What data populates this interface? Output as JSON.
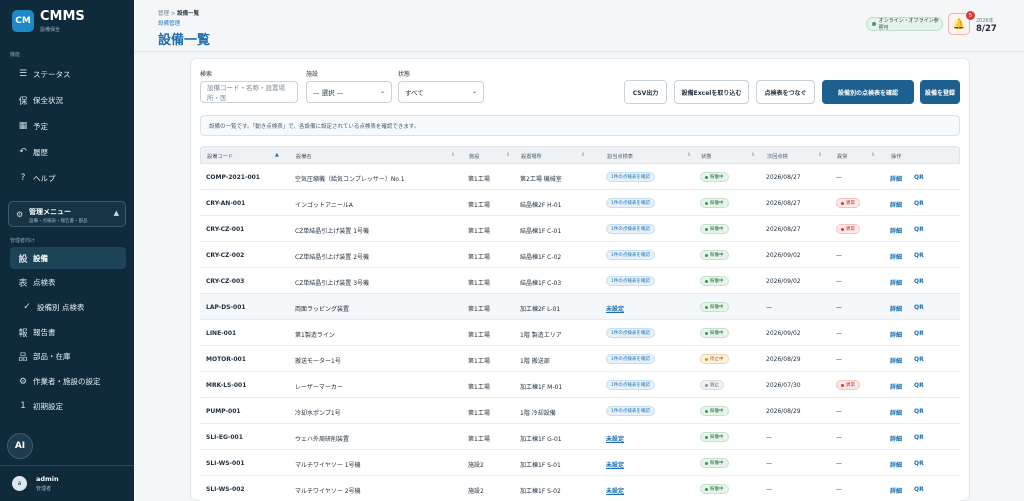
{
  "app": {
    "logo": "CM",
    "name": "CMMS",
    "subtitle": "設備保全"
  },
  "sidebar": {
    "section_main": "機能",
    "items": [
      {
        "label": "ステータス",
        "icon": "list-icon",
        "glyph": "☰"
      },
      {
        "label": "保全状況",
        "icon": "kanji-icon",
        "glyph": "保"
      },
      {
        "label": "予定",
        "icon": "calendar-icon",
        "glyph": "▦"
      },
      {
        "label": "履歴",
        "icon": "history-icon",
        "glyph": "↶"
      },
      {
        "label": "ヘルプ",
        "icon": "help-icon",
        "glyph": "?"
      }
    ],
    "mgmt": {
      "title": "管理メニュー",
      "subtitle": "設備・点検表・報告書・部品",
      "icon": "gear-icon"
    },
    "section_mgmt": "管理者向け",
    "mgmt_items": [
      {
        "label": "設備",
        "icon": "kanji-icon",
        "glyph": "設",
        "active": true
      },
      {
        "label": "点検表",
        "icon": "kanji-icon",
        "glyph": "表"
      },
      {
        "label": "設備別 点検表",
        "icon": "check-icon",
        "glyph": "✓"
      },
      {
        "label": "報告書",
        "icon": "kanji-icon",
        "glyph": "報"
      },
      {
        "label": "部品・在庫",
        "icon": "kanji-icon",
        "glyph": "品"
      },
      {
        "label": "作業者・施設の設定",
        "icon": "gear-icon",
        "glyph": "⚙"
      },
      {
        "label": "初期設定",
        "icon": "number-icon",
        "glyph": "1"
      }
    ],
    "ai_label": "AI",
    "user": {
      "avatar": "a",
      "name": "admin",
      "role": "管理者"
    }
  },
  "header": {
    "crumb_parent": "管理",
    "crumb_sep": ">",
    "crumb_current": "設備一覧",
    "sub_crumb": "設備管理",
    "title": "設備一覧",
    "online": "オンライン・オフライン参照可",
    "bell_count": "5",
    "year": "2026年",
    "date": "8/27"
  },
  "filters": {
    "search_label": "検索",
    "search_placeholder": "設備コード・名称・設置場所・医",
    "facility_label": "施設",
    "facility_value": "— 選択 —",
    "status_label": "状態",
    "status_value": "すべて"
  },
  "actions": {
    "csv": "CSV出力",
    "excel": "設備Excelを取り込む",
    "link": "点検表をつなぐ",
    "check": "設備別の点検表を確認",
    "register": "設備を登録"
  },
  "info_text": "設備の一覧です。「動き点検表」で、各設備に設定されている点検表を確認できます。",
  "table": {
    "headers": [
      "設備コード",
      "設備名",
      "施設",
      "設置場所",
      "割当点検表",
      "状態",
      "次回点検",
      "異常",
      "操作"
    ],
    "detail_label": "詳細",
    "qr_label": "QR",
    "rows": [
      {
        "code": "COMP-2021-001",
        "name": "空気圧縮機（給気コンプレッサー）No.1",
        "facility": "第1工場",
        "location": "第2工場 機械室",
        "checklist": "1件の点検表を確認",
        "unset": false,
        "status": "稼働中",
        "st": "g",
        "next": "2026/08/27",
        "abn": "—",
        "abnormal": false
      },
      {
        "code": "CRY-AN-001",
        "name": "インゴットアニールA",
        "facility": "第1工場",
        "location": "結晶棟2F H-01",
        "checklist": "1件の点検表を確認",
        "unset": false,
        "status": "稼働中",
        "st": "g",
        "next": "2026/08/27",
        "abn": "異常",
        "abnormal": true
      },
      {
        "code": "CRY-CZ-001",
        "name": "CZ単結晶引上げ装置 1号機",
        "facility": "第1工場",
        "location": "結晶棟1F C-01",
        "checklist": "1件の点検表を確認",
        "unset": false,
        "status": "稼働中",
        "st": "g",
        "next": "2026/08/27",
        "abn": "異常",
        "abnormal": true
      },
      {
        "code": "CRY-CZ-002",
        "name": "CZ単結晶引上げ装置 2号機",
        "facility": "第1工場",
        "location": "結晶棟1F C-02",
        "checklist": "1件の点検表を確認",
        "unset": false,
        "status": "稼働中",
        "st": "g",
        "next": "2026/09/02",
        "abn": "—",
        "abnormal": false
      },
      {
        "code": "CRY-CZ-003",
        "name": "CZ単結晶引上げ装置 3号機",
        "facility": "第1工場",
        "location": "結晶棟1F C-03",
        "checklist": "1件の点検表を確認",
        "unset": false,
        "status": "稼働中",
        "st": "g",
        "next": "2026/09/02",
        "abn": "—",
        "abnormal": false
      },
      {
        "code": "LAP-DS-001",
        "name": "両面ラッピング装置",
        "facility": "第1工場",
        "location": "加工棟2F L-01",
        "checklist": "未設定",
        "unset": true,
        "status": "稼働中",
        "st": "g",
        "next": "—",
        "abn": "—",
        "abnormal": false
      },
      {
        "code": "LINE-001",
        "name": "第1製造ライン",
        "facility": "第1工場",
        "location": "1階 製造エリア",
        "checklist": "1件の点検表を確認",
        "unset": false,
        "status": "稼働中",
        "st": "g",
        "next": "2026/09/02",
        "abn": "—",
        "abnormal": false
      },
      {
        "code": "MOTOR-001",
        "name": "搬送モーター1号",
        "facility": "第1工場",
        "location": "1階 搬送部",
        "checklist": "1件の点検表を確認",
        "unset": false,
        "status": "停止中",
        "st": "o",
        "next": "2026/08/29",
        "abn": "—",
        "abnormal": false
      },
      {
        "code": "MRK-LS-001",
        "name": "レーザーマーカー",
        "facility": "第1工場",
        "location": "加工棟1F M-01",
        "checklist": "1件の点検表を確認",
        "unset": false,
        "status": "廃止",
        "st": "x",
        "next": "2026/07/30",
        "abn": "異常",
        "abnormal": true
      },
      {
        "code": "PUMP-001",
        "name": "冷却水ポンプ1号",
        "facility": "第1工場",
        "location": "1階 冷却設備",
        "checklist": "1件の点検表を確認",
        "unset": false,
        "status": "稼働中",
        "st": "g",
        "next": "2026/08/29",
        "abn": "—",
        "abnormal": false
      },
      {
        "code": "SLI-EG-001",
        "name": "ウェハ外周研削装置",
        "facility": "第1工場",
        "location": "加工棟1F G-01",
        "checklist": "未設定",
        "unset": true,
        "status": "稼働中",
        "st": "g",
        "next": "—",
        "abn": "—",
        "abnormal": false
      },
      {
        "code": "SLI-WS-001",
        "name": "マルチワイヤソー 1号機",
        "facility": "施設2",
        "location": "加工棟1F S-01",
        "checklist": "未設定",
        "unset": true,
        "status": "稼働中",
        "st": "g",
        "next": "—",
        "abn": "—",
        "abnormal": false
      },
      {
        "code": "SLI-WS-002",
        "name": "マルチワイヤソー 2号機",
        "facility": "施設2",
        "location": "加工棟1F S-02",
        "checklist": "未設定",
        "unset": true,
        "status": "稼働中",
        "st": "g",
        "next": "—",
        "abn": "—",
        "abnormal": false
      }
    ]
  }
}
